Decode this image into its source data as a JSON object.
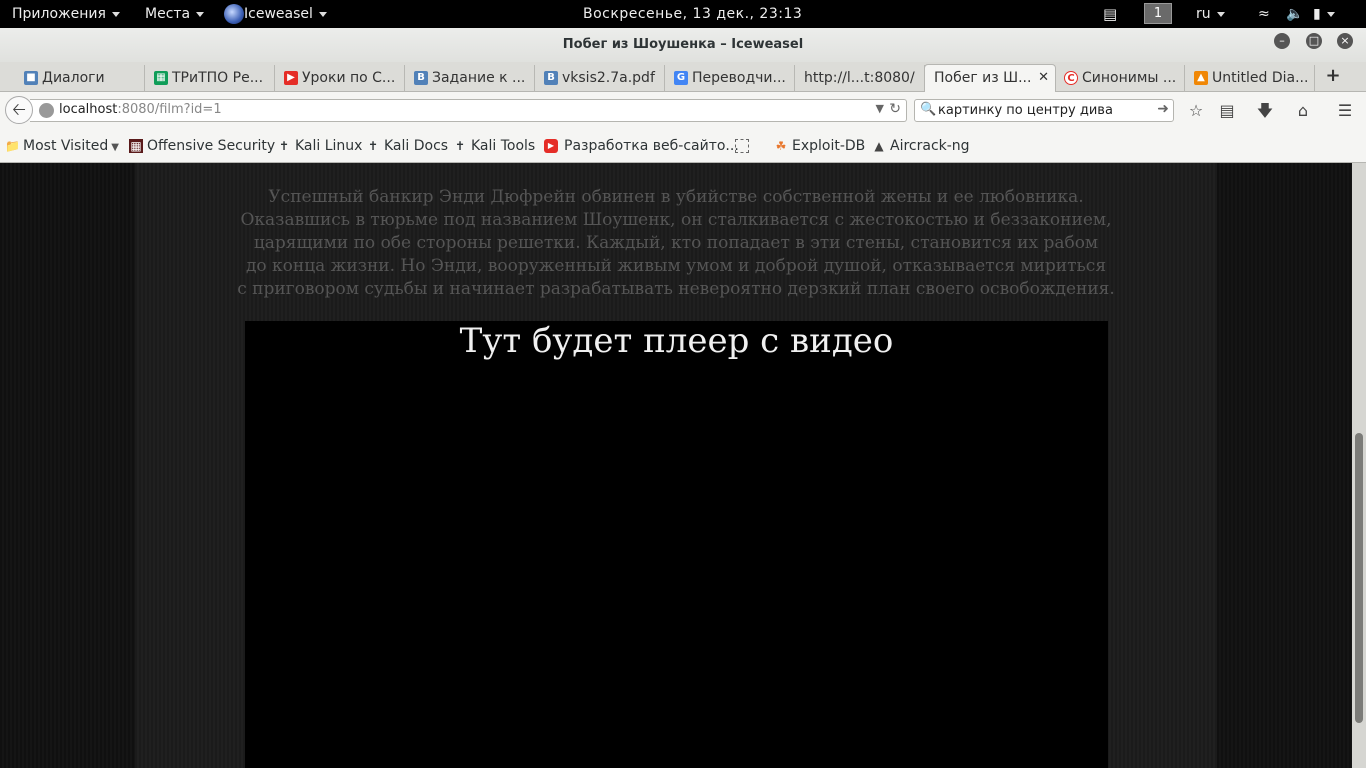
{
  "system_bar": {
    "applications": "Приложения",
    "places": "Места",
    "active_app": "Iceweasel",
    "clock": "Воскресенье, 13 дек., 23:13",
    "workspace": "1",
    "language": "ru"
  },
  "window": {
    "title": "Побег из Шоушенка – Iceweasel"
  },
  "tabs": [
    {
      "label": "Диалоги",
      "icon": "vk-dialog-icon",
      "color": "#5181b8"
    },
    {
      "label": "ТРиТПО Ре...",
      "icon": "google-sheets-icon",
      "color": "#0f9d58"
    },
    {
      "label": "Уроки по С...",
      "icon": "youtube-icon",
      "color": "#e52d27"
    },
    {
      "label": "Задание к ...",
      "icon": "vk-icon",
      "color": "#5181b8"
    },
    {
      "label": "vksis2.7a.pdf",
      "icon": "vk-icon",
      "color": "#5181b8"
    },
    {
      "label": "Переводчи...",
      "icon": "google-translate-icon",
      "color": "#4285f4"
    },
    {
      "label": "http://l...t:8080/",
      "icon": "",
      "color": ""
    },
    {
      "label": "Побег из Ш...",
      "icon": "",
      "color": ""
    },
    {
      "label": "Синонимы ...",
      "icon": "copyright-icon",
      "color": "#e52d27"
    },
    {
      "label": "Untitled Dia...",
      "icon": "drawio-icon",
      "color": "#f08705"
    }
  ],
  "navigation": {
    "url_host": "localhost",
    "url_rest": ":8080/film?id=1",
    "search_query": "картинку по центру дива"
  },
  "bookmarks": [
    {
      "label": "Most Visited",
      "icon": "folder-icon"
    },
    {
      "label": "Offensive Security",
      "icon": "offsec-icon"
    },
    {
      "label": "Kali Linux",
      "icon": "kali-dragon-icon"
    },
    {
      "label": "Kali Docs",
      "icon": "kali-dragon-icon"
    },
    {
      "label": "Kali Tools",
      "icon": "kali-dragon-icon"
    },
    {
      "label": "Разработка веб-сайто...",
      "icon": "youtube-icon"
    },
    {
      "label": "",
      "icon": "blank-page-icon"
    },
    {
      "label": "Exploit-DB",
      "icon": "exploit-db-icon"
    },
    {
      "label": "Aircrack-ng",
      "icon": "aircrack-icon"
    }
  ],
  "content": {
    "description_lines": [
      "Успешный банкир Энди Дюфрейн обвинен в убийстве собственной жены и ее любовника.",
      "Оказавшись в тюрьме под названием Шоушенк, он сталкивается с жестокостью и беззаконием,",
      "царящими по обе стороны решетки. Каждый, кто попадает в эти стены, становится их рабом",
      "до конца жизни. Но Энди, вооруженный живым умом и доброй душой, отказывается мириться",
      "с приговором судьбы и начинает разрабатывать невероятно дерзкий план своего освобождения."
    ],
    "player_placeholder": "Тут будет плеер с видео"
  }
}
